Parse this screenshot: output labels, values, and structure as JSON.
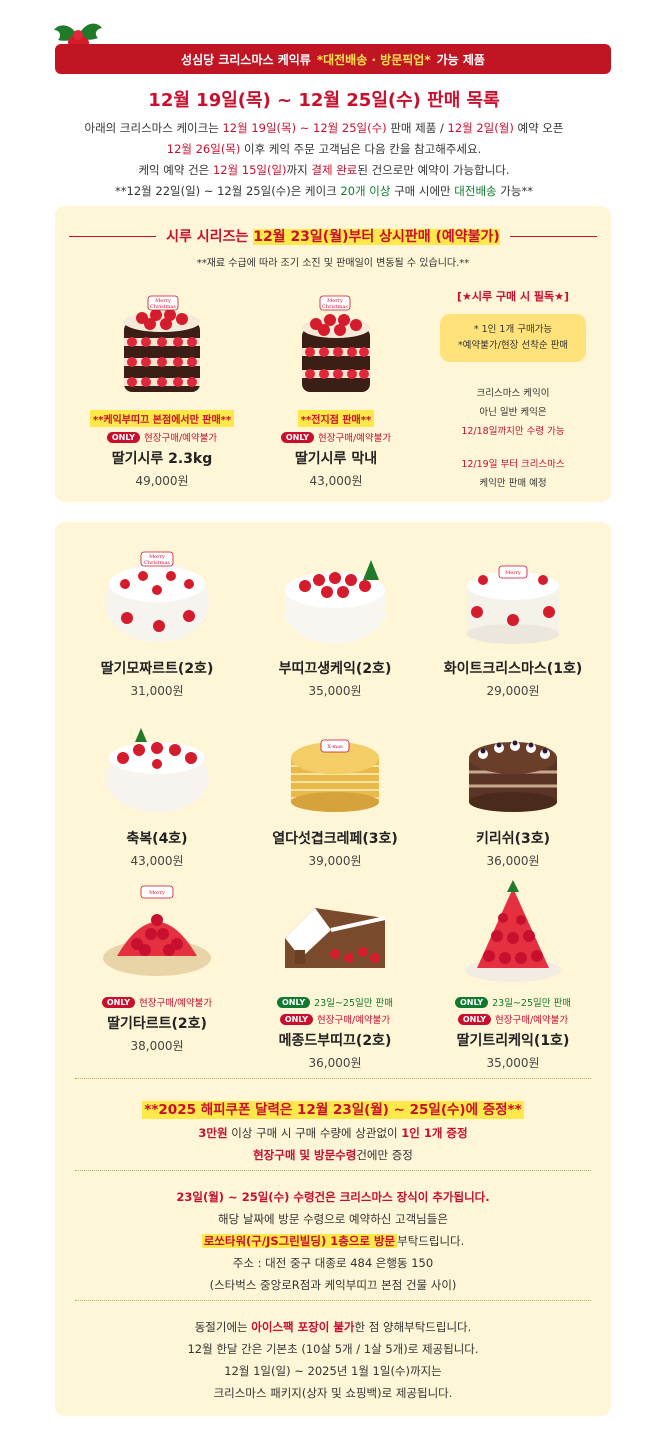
{
  "banner": {
    "title": "성심당 크리스마스 케익류",
    "highlight": "*대전배송 · 방문픽업*",
    "suffix": "가능 제품"
  },
  "main_title": "12월 19일(목) ~ 12월 25일(수) 판매 목록",
  "intro": {
    "l1a": "아래의 크리스마스 케이크는 ",
    "l1b": "12월 19일(목) ~ 12월 25일(수)",
    "l1c": " 판매 제품 / ",
    "l1d": "12월 2일(월)",
    "l1e": " 예약 오픈",
    "l2a": "12월 26일(목)",
    "l2b": " 이후 케익 주문 고객님은 다음 칸을 참고해주세요.",
    "l3a": "케익 예약 건은 ",
    "l3b": "12월 15일(일)",
    "l3c": "까지 ",
    "l3d": "결제 완료",
    "l3e": "된 건으로만 예약이 가능합니다.",
    "l4a": "**12월 22일(일) ~ 12월 25일(수)은 케이크 ",
    "l4b": "20개 이상",
    "l4c": " 구매 시에만 ",
    "l4d": "대전배송",
    "l4e": " 가능**"
  },
  "siru": {
    "title_a": "시루 시리즈는 ",
    "title_b": "12월 23일(월)부터 상시판매 (예약불가)",
    "note": "**재료 수급에 따라 조기 소진 및 판매일이 변동될 수 있습니다.**",
    "products": [
      {
        "tag": "**케익부띠끄 본점에서만 판매**",
        "only": "ONLY",
        "only_text": "현장구매/예약불가",
        "name": "딸기시루 2.3kg",
        "price": "49,000원"
      },
      {
        "tag": "**전지점 판매**",
        "only": "ONLY",
        "only_text": "현장구매/예약불가",
        "name": "딸기시루 막내",
        "price": "43,000원"
      }
    ],
    "side": {
      "title": "[★시루 구매 시 필독★]",
      "pill1": "* 1인 1개 구매가능",
      "pill2": "*예약불가/현장 선착순 판매",
      "t1": "크리스마스 케익이",
      "t2": "아닌 일반 케익은",
      "t3": "12/18일까지만 수령 가능",
      "t4": "12/19일 부터 크리스마스",
      "t5": "케익만 판매 예정"
    }
  },
  "cakes": [
    {
      "name": "딸기모짜르트(2호)",
      "price": "31,000원"
    },
    {
      "name": "부띠끄생케익(2호)",
      "price": "35,000원"
    },
    {
      "name": "화이트크리스마스(1호)",
      "price": "29,000원"
    },
    {
      "name": "축복(4호)",
      "price": "43,000원"
    },
    {
      "name": "열다섯겹크레페(3호)",
      "price": "39,000원"
    },
    {
      "name": "키리쉬(3호)",
      "price": "36,000원"
    },
    {
      "name": "딸기타르트(2호)",
      "price": "38,000원",
      "only_text": "현장구매/예약불가"
    },
    {
      "name": "메종드부띠끄(2호)",
      "price": "36,000원",
      "only_g": "23일~25일만 판매",
      "only_text": "현장구매/예약불가"
    },
    {
      "name": "딸기트리케익(1호)",
      "price": "35,000원",
      "only_g": "23일~25일만 판매",
      "only_text": "현장구매/예약불가"
    }
  ],
  "only_label": "ONLY",
  "cake_text": {
    "merry": "Merry",
    "christmas": "Christmas",
    "xmas": "X-mas"
  },
  "coupon": {
    "title_a": "**2025 해피쿠폰 달력은 ",
    "title_b": "12월 23일(월) ~ 25일(수)",
    "title_c": "에 증정**",
    "l1a": "3만원",
    "l1b": " 이상 구매 시 구매 수량에 상관없이 ",
    "l1c": "1인 1개 증정",
    "l2a": "현장구매 및 방문수령",
    "l2b": "건에만 증정"
  },
  "pickup": {
    "l1a": "23일(월) ~ 25일(수) 수령건은 ",
    "l1b": "크리스마스 장식이 추가",
    "l1c": "됩니다.",
    "l2": "해당 날짜에 방문 수령으로 예약하신 고객님들은",
    "l3a": "로쏘타워(구/JS그린빌딩) 1층으로 방문",
    "l3b": "부탁드립니다.",
    "l4": "주소 : 대전 중구 대종로 484 은행동 150",
    "l5": "(스타벅스 중앙로R점과 케익부띠끄 본점 건물 사이)"
  },
  "winter": {
    "l1a": "동절기에는 ",
    "l1b": "아이스팩 포장이 불가",
    "l1c": "한 점 양해부탁드립니다.",
    "l2": "12월 한달 간은 기본초 (10살 5개 / 1살 5개)로 제공됩니다.",
    "l3": "12월 1일(일) ~ 2025년 1월 1일(수)까지는",
    "l4": "크리스마스 패키지(상자 및 쇼핑백)로 제공됩니다."
  }
}
